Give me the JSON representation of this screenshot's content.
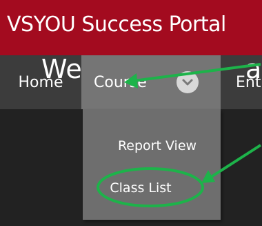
{
  "header": {
    "title": "VSYOU Success Portal",
    "background": "#a30b1f"
  },
  "nav": {
    "home_label": "Home",
    "course_label": "Course",
    "next_label_partial": "Ent",
    "chevron_icon": "chevron-down-icon"
  },
  "dropdown": {
    "items": [
      {
        "label": "Report View"
      },
      {
        "label": "Class List"
      }
    ]
  },
  "main": {
    "welcome_partial": "We",
    "welcome_tail_partial": "a"
  },
  "annotations": {
    "color": "#1db34a",
    "arrows": 2,
    "ellipse_target": "Class List"
  }
}
